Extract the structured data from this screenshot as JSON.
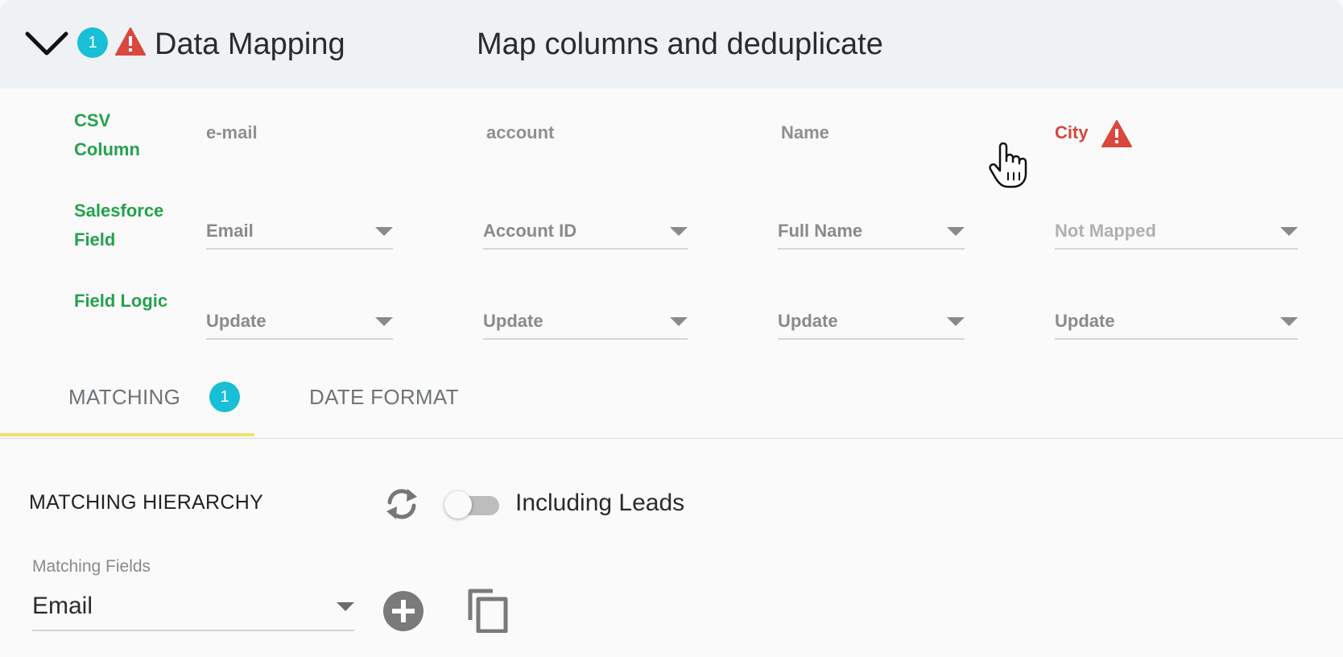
{
  "header": {
    "title": "Data Mapping",
    "subtitle": "Map columns and deduplicate",
    "issue_count": "1"
  },
  "mapping": {
    "row_labels": {
      "csv_column": "CSV Column",
      "salesforce_field": "Salesforce Field",
      "field_logic": "Field Logic"
    },
    "columns": [
      {
        "csv": "e-mail",
        "salesforce_field": "Email",
        "field_logic": "Update",
        "has_error": false
      },
      {
        "csv": "account",
        "salesforce_field": "Account ID",
        "field_logic": "Update",
        "has_error": false
      },
      {
        "csv": "Name",
        "salesforce_field": "Full Name",
        "field_logic": "Update",
        "has_error": false
      },
      {
        "csv": "City",
        "salesforce_field": "Not Mapped",
        "field_logic": "Update",
        "has_error": true
      }
    ]
  },
  "tabs": [
    {
      "label": "MATCHING",
      "badge": "1",
      "active": true
    },
    {
      "label": "DATE FORMAT",
      "active": false
    }
  ],
  "matching": {
    "section_title": "MATCHING HIERARCHY",
    "toggle_label": "Including Leads",
    "toggle_on": false,
    "fields_label": "Matching Fields",
    "fields_value": "Email"
  },
  "colors": {
    "accent_teal": "#18bfd6",
    "label_green": "#23a24d",
    "error_red": "#d9473d",
    "tab_ink_yellow": "#f2e36b",
    "header_bg": "#eff2f4"
  },
  "icons": [
    "chevron-down-icon",
    "warning-icon",
    "refresh-icon",
    "add-circle-icon",
    "copy-icon",
    "hand-cursor-icon"
  ]
}
